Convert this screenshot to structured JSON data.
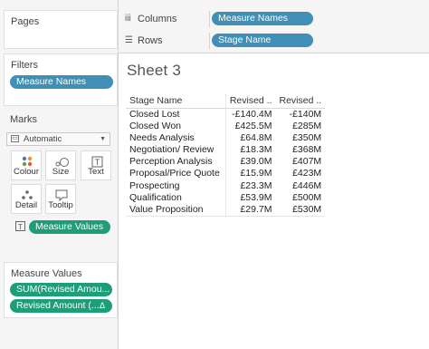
{
  "pages": {
    "title": "Pages"
  },
  "filters": {
    "title": "Filters",
    "pill": "Measure Names"
  },
  "marks": {
    "title": "Marks",
    "mark_type": "Automatic",
    "buttons": [
      {
        "label": "Colour",
        "icon": "color-dots-icon"
      },
      {
        "label": "Size",
        "icon": "size-circles-icon"
      },
      {
        "label": "Text",
        "icon": "text-box-icon"
      },
      {
        "label": "Detail",
        "icon": "detail-dots-icon"
      },
      {
        "label": "Tooltip",
        "icon": "tooltip-bubble-icon"
      }
    ],
    "measure_values_pill": "Measure Values"
  },
  "measure_values": {
    "title": "Measure Values",
    "pills": [
      "SUM(Revised Amou...",
      "Revised Amount (..."
    ]
  },
  "shelves": {
    "columns": {
      "label": "Columns",
      "pill": "Measure Names"
    },
    "rows": {
      "label": "Rows",
      "pill": "Stage Name"
    }
  },
  "sheet": {
    "title": "Sheet 3",
    "headers": [
      "Stage Name",
      "Revised ..",
      "Revised .."
    ],
    "rows": [
      [
        "Closed Lost",
        "-£140.4M",
        "-£140M"
      ],
      [
        "Closed Won",
        "£425.5M",
        "£285M"
      ],
      [
        "Needs Analysis",
        "£64.8M",
        "£350M"
      ],
      [
        "Negotiation/ Review",
        "£18.3M",
        "£368M"
      ],
      [
        "Perception Analysis",
        "£39.0M",
        "£407M"
      ],
      [
        "Proposal/Price Quote",
        "£15.9M",
        "£423M"
      ],
      [
        "Prospecting",
        "£23.3M",
        "£446M"
      ],
      [
        "Qualification",
        "£53.9M",
        "£500M"
      ],
      [
        "Value Proposition",
        "£29.7M",
        "£530M"
      ]
    ]
  },
  "colors": {
    "green_pill": "#1e9e78",
    "blue_pill": "#3f8fb7"
  }
}
